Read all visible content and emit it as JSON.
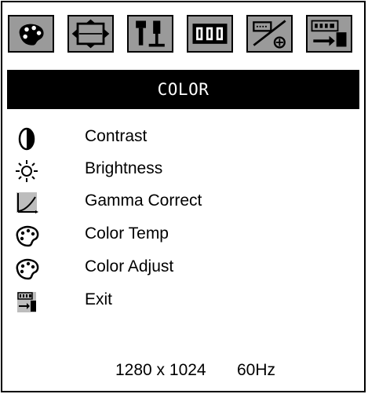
{
  "toolbar": {
    "tabs": [
      {
        "name": "color-palette-icon"
      },
      {
        "name": "size-position-icon"
      },
      {
        "name": "setup-tools-icon"
      },
      {
        "name": "osd-icon"
      },
      {
        "name": "input-settings-icon"
      },
      {
        "name": "exit-icon"
      }
    ]
  },
  "header": {
    "title": "COLOR"
  },
  "menu": {
    "items": [
      {
        "label": "Contrast",
        "icon": "contrast-icon"
      },
      {
        "label": "Brightness",
        "icon": "brightness-icon"
      },
      {
        "label": "Gamma Correct",
        "icon": "gamma-curve-icon"
      },
      {
        "label": "Color Temp",
        "icon": "palette-icon"
      },
      {
        "label": "Color Adjust",
        "icon": "palette-icon"
      },
      {
        "label": "Exit",
        "icon": "exit-icon"
      }
    ]
  },
  "status": {
    "resolution": "1280 x 1024",
    "refresh": "60Hz"
  }
}
